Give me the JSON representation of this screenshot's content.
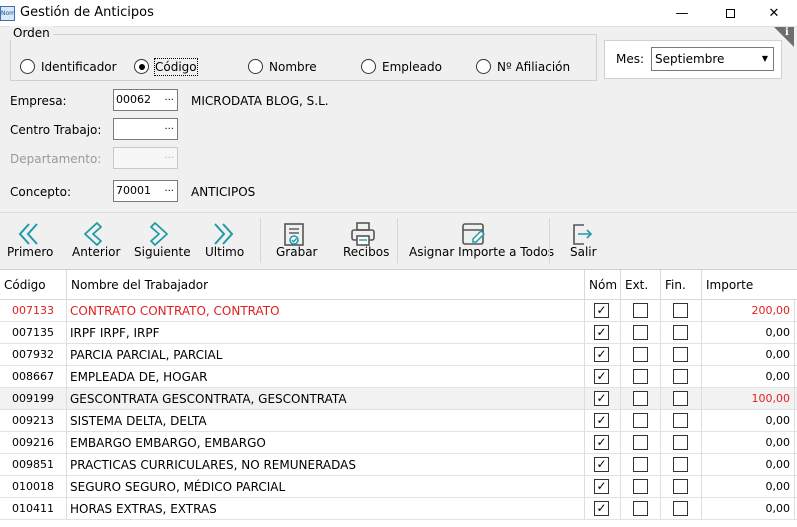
{
  "window": {
    "app_icon_text": "Nom",
    "title": "Gestión de Anticipos",
    "minimize_glyph": "—",
    "close_glyph": "✕",
    "info_glyph": "i"
  },
  "orden": {
    "legend": "Orden",
    "options": [
      {
        "label": "Identificador",
        "selected": false
      },
      {
        "label": "Código",
        "selected": true
      },
      {
        "label": "Nombre",
        "selected": false
      },
      {
        "label": "Empleado",
        "selected": false
      },
      {
        "label": "Nº Afiliación",
        "selected": false
      }
    ]
  },
  "mes": {
    "label": "Mes:",
    "value": "Septiembre"
  },
  "form": {
    "empresa": {
      "label": "Empresa:",
      "code": "00062",
      "description": "MICRODATA BLOG, S.L."
    },
    "centro": {
      "label": "Centro Trabajo:",
      "code": "",
      "description": ""
    },
    "departamento": {
      "label": "Departamento:",
      "code": "",
      "description": ""
    },
    "concepto": {
      "label": "Concepto:",
      "code": "70001",
      "description": "ANTICIPOS"
    },
    "lookup_glyph": "..."
  },
  "toolbar": {
    "primero": "Primero",
    "anterior": "Anterior",
    "siguiente": "Siguiente",
    "ultimo": "Ultimo",
    "grabar": "Grabar",
    "recibos": "Recibos",
    "asignar": "Asignar Importe a Todos",
    "salir": "Salir"
  },
  "colors": {
    "accent": "#1f9aa6",
    "highlight_text": "#e01f1f"
  },
  "grid": {
    "headers": {
      "codigo": "Código",
      "nombre": "Nombre del Trabajador",
      "nom": "Nóm",
      "ext": "Ext.",
      "fin": "Fin.",
      "importe": "Importe"
    },
    "check_glyph": "✓",
    "rows": [
      {
        "codigo": "007133",
        "nombre": "CONTRATO CONTRATO, CONTRATO",
        "nom": true,
        "ext": false,
        "fin": false,
        "importe": "200,00",
        "highlight": true
      },
      {
        "codigo": "007135",
        "nombre": "IRPF IRPF, IRPF",
        "nom": true,
        "ext": false,
        "fin": false,
        "importe": "0,00",
        "highlight": false
      },
      {
        "codigo": "007932",
        "nombre": "PARCIA PARCIAL, PARCIAL",
        "nom": true,
        "ext": false,
        "fin": false,
        "importe": "0,00",
        "highlight": false
      },
      {
        "codigo": "008667",
        "nombre": "EMPLEADA DE, HOGAR",
        "nom": true,
        "ext": false,
        "fin": false,
        "importe": "0,00",
        "highlight": false
      },
      {
        "codigo": "009199",
        "nombre": "GESCONTRATA GESCONTRATA, GESCONTRATA",
        "nom": true,
        "ext": false,
        "fin": false,
        "importe": "100,00",
        "highlight": false,
        "importe_red": true
      },
      {
        "codigo": "009213",
        "nombre": "SISTEMA DELTA, DELTA",
        "nom": true,
        "ext": false,
        "fin": false,
        "importe": "0,00",
        "highlight": false
      },
      {
        "codigo": "009216",
        "nombre": "EMBARGO EMBARGO, EMBARGO",
        "nom": true,
        "ext": false,
        "fin": false,
        "importe": "0,00",
        "highlight": false
      },
      {
        "codigo": "009851",
        "nombre": "PRACTICAS CURRICULARES, NO REMUNERADAS",
        "nom": true,
        "ext": false,
        "fin": false,
        "importe": "0,00",
        "highlight": false
      },
      {
        "codigo": "010018",
        "nombre": "SEGURO SEGURO, MÉDICO PARCIAL",
        "nom": true,
        "ext": false,
        "fin": false,
        "importe": "0,00",
        "highlight": false
      },
      {
        "codigo": "010411",
        "nombre": "HORAS EXTRAS, EXTRAS",
        "nom": true,
        "ext": false,
        "fin": false,
        "importe": "0,00",
        "highlight": false
      }
    ]
  }
}
